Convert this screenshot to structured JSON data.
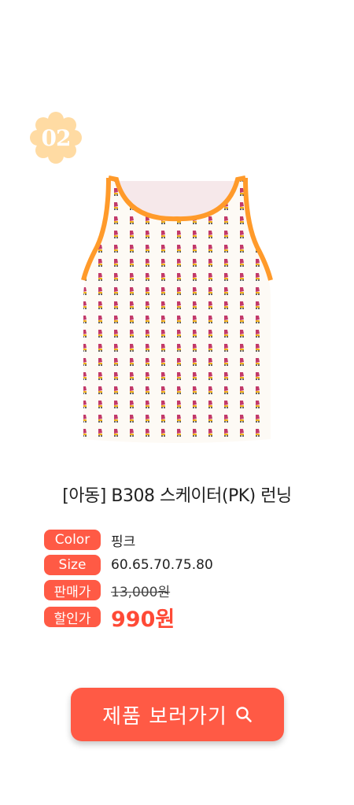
{
  "badge": {
    "number": "02",
    "color": "#ffdba3"
  },
  "product": {
    "title": "[아동] B308 스케이터(PK) 런닝",
    "image_icon": "tank-top-image",
    "trim_color": "#ff9a2a"
  },
  "info": {
    "color_label": "Color",
    "color_value": "핑크",
    "size_label": "Size",
    "size_value": "60.65.70.75.80",
    "price_label": "판매가",
    "price_value": "13,000원",
    "sale_label": "할인가",
    "sale_value": "990원"
  },
  "cta": {
    "label": "제품 보러가기",
    "icon": "search-icon"
  },
  "colors": {
    "accent": "#ff5a45",
    "sale_text": "#ff4a36"
  }
}
